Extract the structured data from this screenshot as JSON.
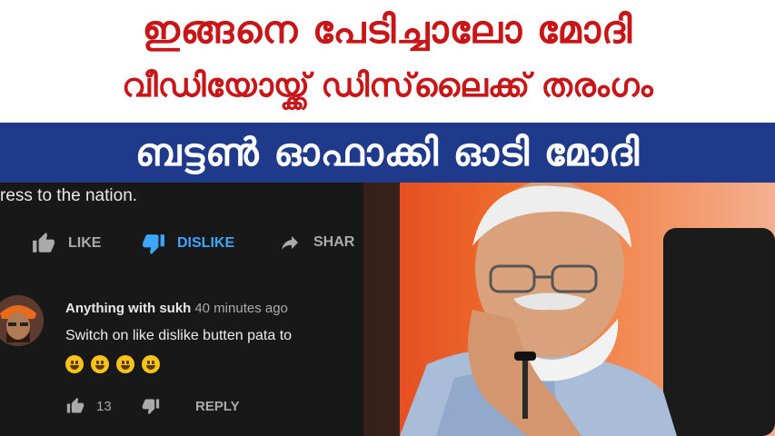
{
  "headline": {
    "line1": "ഇങ്ങനെ പേടിച്ചാലോ മോദി",
    "line2": "വീഡിയോയ്ക്ക് ഡിസ്‌ലൈക്ക് തരംഗം",
    "line3": "ബട്ടൺ ഓഫാക്കി ഓടി മോദി"
  },
  "video": {
    "description_fragment": "ress to the nation.",
    "like_label": "LIKE",
    "dislike_label": "DISLIKE",
    "share_label": "SHAR"
  },
  "comment": {
    "author": "Anything with sukh",
    "time": "40 minutes ago",
    "text": "Switch on like dislike butten pata to",
    "emoji_name": "grinning-face",
    "emoji_count": 4,
    "like_count": "13",
    "reply_label": "REPLY"
  },
  "colors": {
    "headline_red": "#c81517",
    "banner_blue": "#1f3a8a",
    "youtube_dark": "#181818",
    "dislike_active": "#3ea6ff"
  }
}
